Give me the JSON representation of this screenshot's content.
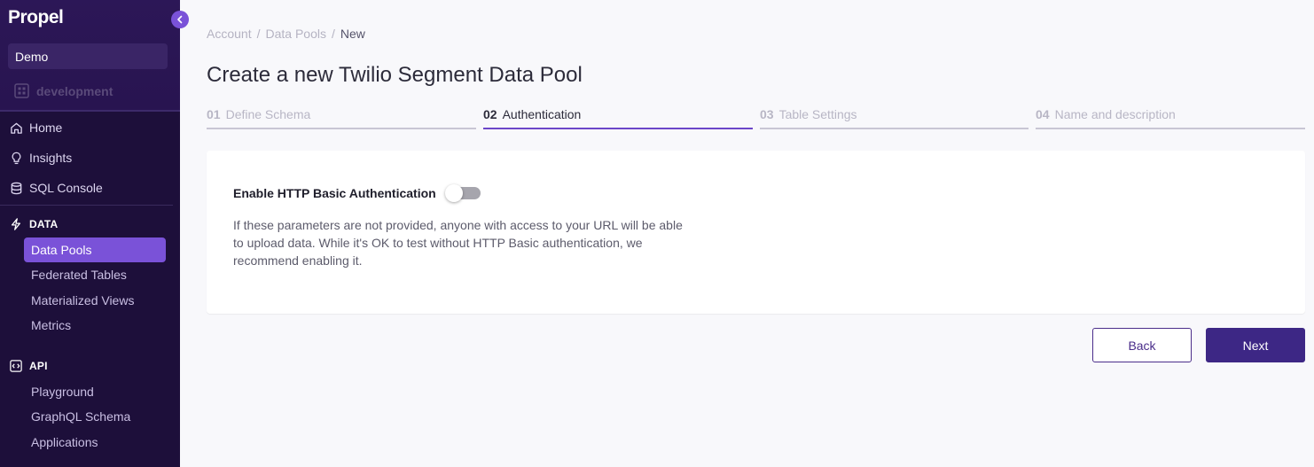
{
  "sidebar": {
    "logo": "Propel",
    "environment": "Demo",
    "sub_environment": "development",
    "nav": [
      {
        "label": "Home",
        "icon": "home-icon"
      },
      {
        "label": "Insights",
        "icon": "lightbulb-icon"
      },
      {
        "label": "SQL Console",
        "icon": "database-icon"
      }
    ],
    "data_section": {
      "title": "DATA",
      "icon": "bolt-icon",
      "items": [
        "Data Pools",
        "Federated Tables",
        "Materialized Views",
        "Metrics"
      ],
      "active": "Data Pools"
    },
    "api_section": {
      "title": "API",
      "icon": "code-icon",
      "items": [
        "Playground",
        "GraphQL Schema",
        "Applications"
      ]
    }
  },
  "breadcrumb": [
    "Account",
    "Data Pools",
    "New"
  ],
  "title": "Create a new Twilio Segment Data Pool",
  "steps": [
    {
      "num": "01",
      "label": "Define Schema"
    },
    {
      "num": "02",
      "label": "Authentication"
    },
    {
      "num": "03",
      "label": "Table Settings"
    },
    {
      "num": "04",
      "label": "Name and description"
    }
  ],
  "active_step": "02",
  "auth": {
    "label": "Enable HTTP Basic Authentication",
    "enabled": false,
    "description": "If these parameters are not provided, anyone with access to your URL will be able to upload data. While it's OK to test without HTTP Basic authentication, we recommend enabling it."
  },
  "buttons": {
    "back": "Back",
    "next": "Next"
  },
  "colors": {
    "accent": "#7a52d8",
    "sidebar_bg": "#1d0f3a",
    "primary_button": "#3d2785"
  }
}
